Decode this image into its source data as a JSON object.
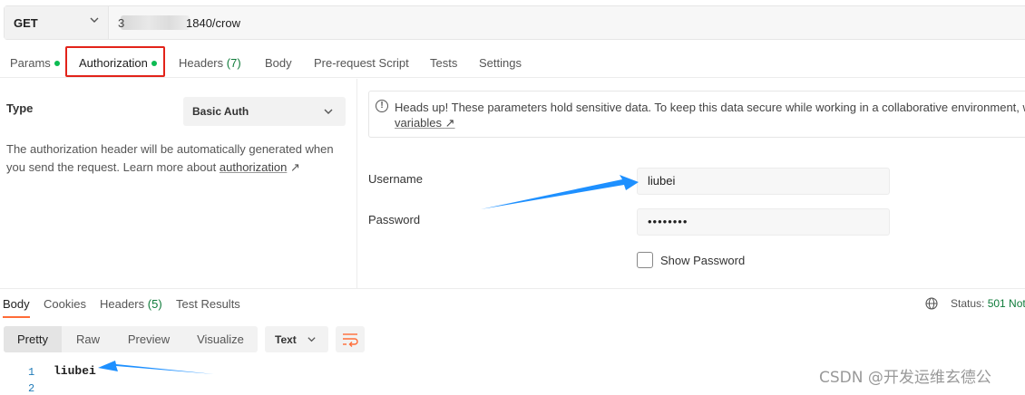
{
  "request": {
    "method": "GET",
    "url_prefix": "3",
    "url_visible": "1840/crow"
  },
  "request_tabs": [
    {
      "label": "Params",
      "dot": true
    },
    {
      "label": "Authorization",
      "dot": true,
      "active": true
    },
    {
      "label": "Headers",
      "count": "(7)"
    },
    {
      "label": "Body"
    },
    {
      "label": "Pre-request Script"
    },
    {
      "label": "Tests"
    },
    {
      "label": "Settings"
    }
  ],
  "auth": {
    "type_label": "Type",
    "type_value": "Basic Auth",
    "description": "The authorization header will be automatically generated when you send the request. Learn more about ",
    "description_link": "authorization",
    "notice_text": "Heads up! These parameters hold sensitive data. To keep this data secure while working in a collaborative environment, we",
    "notice_link": "variables",
    "username_label": "Username",
    "username_value": "liubei",
    "password_label": "Password",
    "password_value": "••••••••",
    "show_password_label": "Show Password"
  },
  "response_tabs": [
    {
      "label": "Body",
      "active": true
    },
    {
      "label": "Cookies"
    },
    {
      "label": "Headers",
      "count": "(5)"
    },
    {
      "label": "Test Results"
    }
  ],
  "response_status": {
    "label": "Status:",
    "value": "501 Not"
  },
  "view_modes": [
    "Pretty",
    "Raw",
    "Preview",
    "Visualize"
  ],
  "format": "Text",
  "code_lines": [
    {
      "num": "1",
      "text": "liubei"
    },
    {
      "num": "2",
      "text": ""
    }
  ],
  "watermark": "CSDN @开发运维玄德公",
  "colors": {
    "accent": "#ff6c37",
    "highlight_box": "#e2231a",
    "arrow": "#1e90ff",
    "dot": "#0cbb52"
  }
}
